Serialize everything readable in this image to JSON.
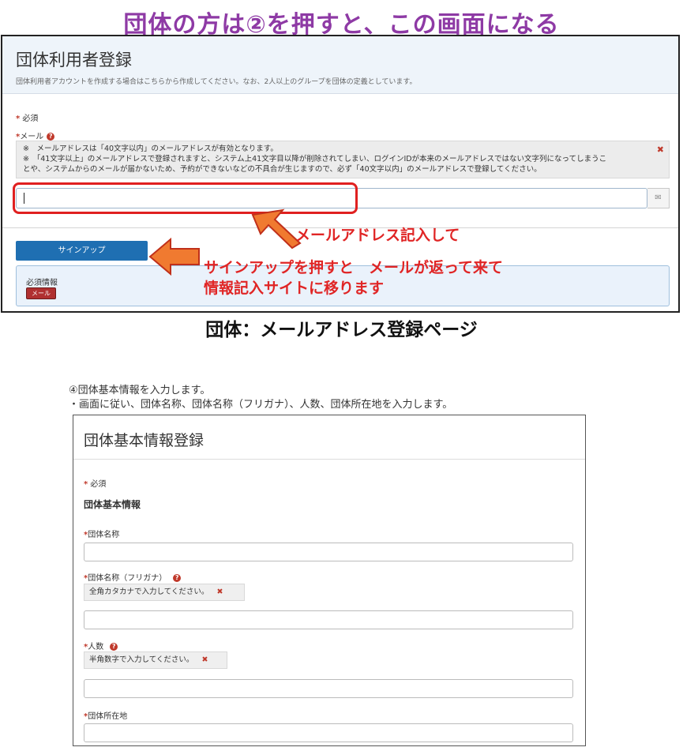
{
  "header": {
    "title": "団体の方は②を押すと、この画面になる"
  },
  "signup_page": {
    "title": "団体利用者登録",
    "description": "団体利用者アカウントを作成する場合はこちらから作成してください。なお、2人以上のグループを団体の定義としています。",
    "required_marker": "*",
    "required_label": "必須",
    "email_label": "メール",
    "email_notes": [
      "※　メールアドレスは「40文字以内」のメールアドレスが有効となります。",
      "※　「41文字以上」のメールアドレスで登録されますと、システム上41文字目以降が削除されてしまい、ログインIDが本来のメールアドレスではない文字列になってしまうこ",
      "とや、システムからのメールが届かないため、予約ができないなどの不具合が生じますので、必ず「40文字以内」のメールアドレスで登録してください。"
    ],
    "close_icon_glyph": "✖",
    "email_value": "",
    "email_addon_glyph": "✉",
    "signup_button": "サインアップ",
    "required_info_title": "必須情報",
    "required_info_badge": "メール"
  },
  "annotations": {
    "email": "メールアドレス記入して",
    "signup_line1": "サインアップを押すと　メールが返って来て",
    "signup_line2": "情報記入サイトに移ります"
  },
  "caption": "団体：メールアドレス登録ページ",
  "step": {
    "line1": "④団体基本情報を入力します。",
    "line2": "・画面に従い、団体名称、団体名称（フリガナ）、人数、団体所在地を入力します。"
  },
  "basic_info_page": {
    "title": "団体基本情報登録",
    "required_label": "必須",
    "section_title": "団体基本情報",
    "fields": [
      {
        "label": "団体名称",
        "hint": "",
        "value": ""
      },
      {
        "label": "団体名称（フリガナ）",
        "hint": "全角カタカナで入力してください。",
        "value": ""
      },
      {
        "label": "人数",
        "hint": "半角数字で入力してください。",
        "value": ""
      },
      {
        "label": "団体所在地",
        "hint": "",
        "value": ""
      }
    ],
    "hint_close_glyph": "✖",
    "help_glyph": "?"
  },
  "colors": {
    "title_purple": "#8e3aa5",
    "annotation_red": "#e02525",
    "arrow_orange": "#f07a30",
    "primary_blue": "#1f6fb2"
  }
}
